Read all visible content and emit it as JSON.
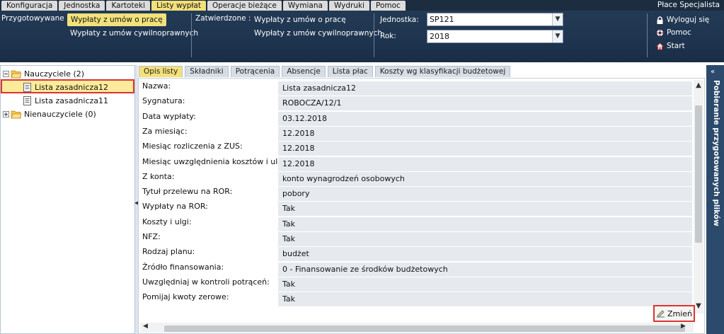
{
  "menu": [
    "Konfiguracja",
    "Jednostka",
    "Kartoteki",
    "Listy wypłat",
    "Operacje bieżące",
    "Wymiana",
    "Wydruki",
    "Pomoc"
  ],
  "active_menu": "Listy wypłat",
  "app_title": "Płace Specjalista",
  "toolbar": {
    "przygotowywane_label": "Przygotowywane :",
    "przygotowywane_items": [
      "Wypłaty z umów o pracę",
      "Wypłaty z umów cywilnoprawnych"
    ],
    "zatwierdzone_label": "Zatwierdzone :",
    "zatwierdzone_items": [
      "Wypłaty z umów o pracę",
      "Wypłaty z umów cywilnoprawnych"
    ],
    "jednostka_label": "Jednostka:",
    "jednostka_value": "SP121",
    "rok_label": "Rok:",
    "rok_value": "2018",
    "logout": "Wyloguj się",
    "help": "Pomoc",
    "start": "Start"
  },
  "tree": {
    "groups": [
      {
        "label": "Nauczyciele (2)",
        "items": [
          "Lista zasadnicza12",
          "Lista zasadnicza11"
        ]
      },
      {
        "label": "Nienauczyciele (0)",
        "items": []
      }
    ],
    "selected": "Lista zasadnicza12"
  },
  "tabs": [
    "Opis listy",
    "Składniki",
    "Potrącenia",
    "Absencje",
    "Lista płac",
    "Koszty wg klasyfikacji budżetowej"
  ],
  "active_tab": "Opis listy",
  "fields": [
    {
      "label": "Nazwa:",
      "value": "Lista zasadnicza12"
    },
    {
      "label": "Sygnatura:",
      "value": "ROBOCZA/12/1"
    },
    {
      "label": "Data wypłaty:",
      "value": "03.12.2018"
    },
    {
      "label": "Za miesiąc:",
      "value": "12.2018"
    },
    {
      "label": "Miesiąc rozliczenia z ZUS:",
      "value": "12.2018"
    },
    {
      "label": "Miesiąc uwzględnienia kosztów i ulg:",
      "value": "12.2018"
    },
    {
      "label": "Z konta:",
      "value": "konto wynagrodzeń osobowych"
    },
    {
      "label": "Tytuł przelewu na ROR:",
      "value": "pobory"
    },
    {
      "label": "Wypłaty na ROR:",
      "value": "Tak"
    },
    {
      "label": "Koszty i ulgi:",
      "value": "Tak"
    },
    {
      "label": "NFZ:",
      "value": "Tak"
    },
    {
      "label": "Rodzaj planu:",
      "value": "budżet"
    },
    {
      "label": "Źródło finansowania:",
      "value": "0 - Finansowanie ze środków budżetowych"
    },
    {
      "label": "Uwzględniaj w kontroli potrąceń:",
      "value": "Tak"
    },
    {
      "label": "Pomijaj kwoty zerowe:",
      "value": "Tak"
    }
  ],
  "change_button": "Zmień",
  "side_panel_label": "Pobieranie przygotowanych plików",
  "colors": {
    "navy": "#1f3550",
    "highlight": "#f3e07a",
    "selection_border": "#d33333"
  }
}
